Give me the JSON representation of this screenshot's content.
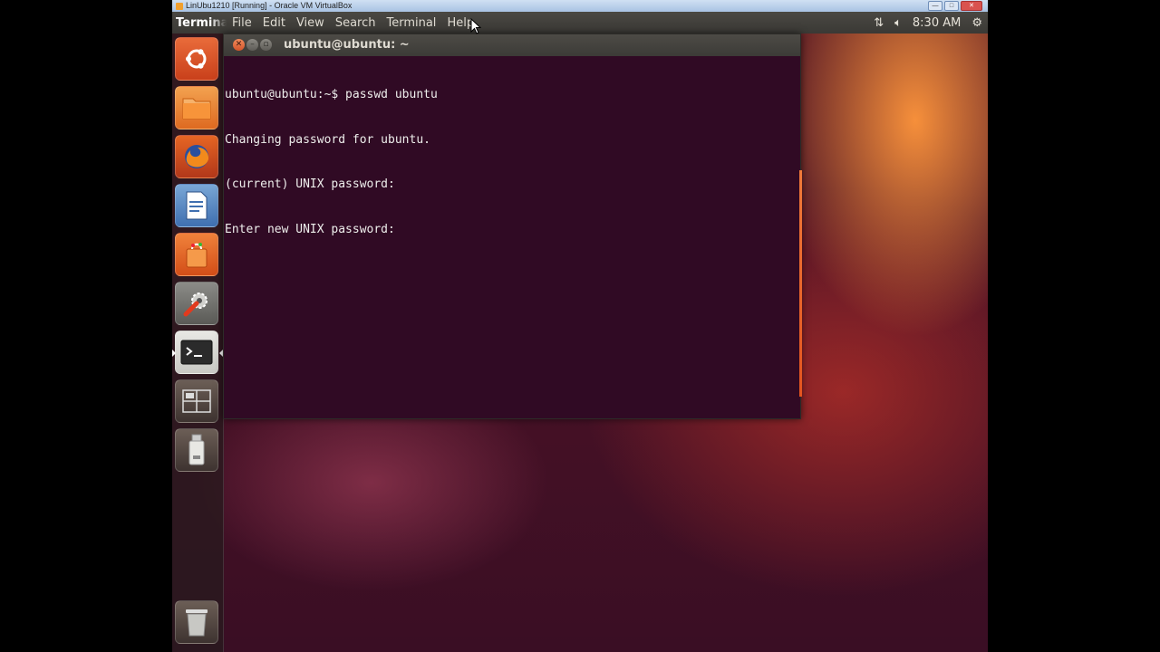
{
  "host_window": {
    "title": "LinUbu1210 [Running] - Oracle VM VirtualBox",
    "controls": [
      "—",
      "□",
      "✕"
    ]
  },
  "top_panel": {
    "app_title": "Terminal",
    "menus": [
      "File",
      "Edit",
      "View",
      "Search",
      "Terminal",
      "Help"
    ],
    "clock": "8:30 AM",
    "icons": [
      "network-icon",
      "volume-icon",
      "gear-icon"
    ]
  },
  "launcher": {
    "items": [
      {
        "name": "dash-home",
        "icon": "ubuntu-logo-icon"
      },
      {
        "name": "files",
        "icon": "folder-icon"
      },
      {
        "name": "firefox",
        "icon": "firefox-icon"
      },
      {
        "name": "libreoffice-writer",
        "icon": "document-icon"
      },
      {
        "name": "software-center",
        "icon": "shopping-bag-icon"
      },
      {
        "name": "system-settings",
        "icon": "wrench-gear-icon"
      },
      {
        "name": "terminal",
        "icon": "terminal-icon",
        "active": true
      },
      {
        "name": "workspace-switcher",
        "icon": "workspaces-icon"
      },
      {
        "name": "usb-drive",
        "icon": "usb-icon"
      },
      {
        "name": "trash",
        "icon": "trash-icon"
      }
    ]
  },
  "terminal": {
    "title": "ubuntu@ubuntu: ~",
    "lines": [
      "ubuntu@ubuntu:~$ passwd ubuntu",
      "Changing password for ubuntu.",
      "(current) UNIX password:",
      "Enter new UNIX password:"
    ]
  },
  "colors": {
    "terminal_bg": "#300a24",
    "terminal_fg": "#eeeeec",
    "panel_bg": "#3c3b37",
    "accent": "#dd4814"
  }
}
